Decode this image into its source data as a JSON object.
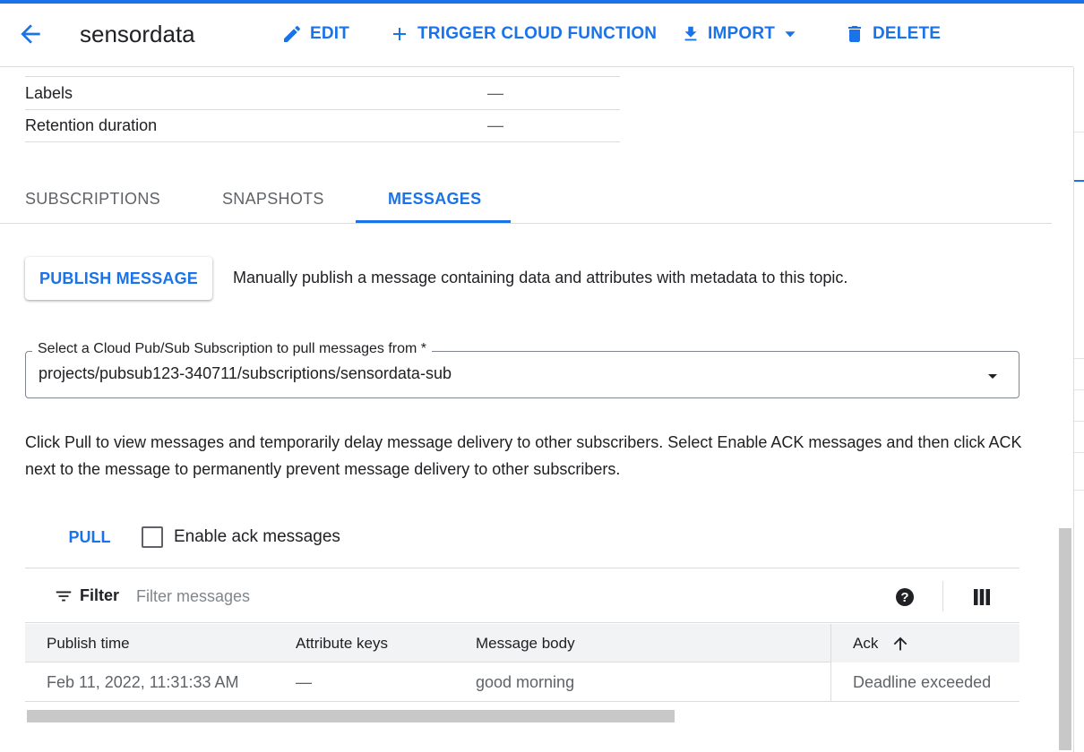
{
  "header": {
    "title": "sensordata",
    "edit_label": "EDIT",
    "trigger_label": "TRIGGER CLOUD FUNCTION",
    "import_label": "IMPORT",
    "delete_label": "DELETE"
  },
  "properties": {
    "rows": [
      {
        "label": "Labels",
        "value": "—"
      },
      {
        "label": "Retention duration",
        "value": "—"
      }
    ]
  },
  "tabs": [
    {
      "label": "SUBSCRIPTIONS"
    },
    {
      "label": "SNAPSHOTS"
    },
    {
      "label": "MESSAGES",
      "active": true
    }
  ],
  "publish": {
    "button_label": "PUBLISH MESSAGE",
    "description": "Manually publish a message containing data and attributes with metadata to this topic."
  },
  "subscription_select": {
    "legend": "Select a Cloud Pub/Sub Subscription to pull messages from *",
    "value": "projects/pubsub123-340711/subscriptions/sensordata-sub"
  },
  "help_text": "Click Pull to view messages and temporarily delay message delivery to other subscribers. Select Enable ACK messages and then click ACK next to the message to permanently prevent message delivery to other subscribers.",
  "pull": {
    "button_label": "PULL",
    "enable_ack_label": "Enable ack messages",
    "enable_ack_checked": false
  },
  "filter": {
    "label": "Filter",
    "placeholder": "Filter messages"
  },
  "table": {
    "columns": [
      "Publish time",
      "Attribute keys",
      "Message body",
      "Ack"
    ],
    "rows": [
      {
        "publish_time": "Feb 11, 2022, 11:31:33 AM",
        "attribute_keys": "—",
        "message_body": "good morning",
        "ack": "Deadline exceeded"
      }
    ]
  },
  "colors": {
    "accent": "#1a73e8",
    "text": "#202124",
    "muted": "#5f6368",
    "divider": "#dadce0"
  }
}
